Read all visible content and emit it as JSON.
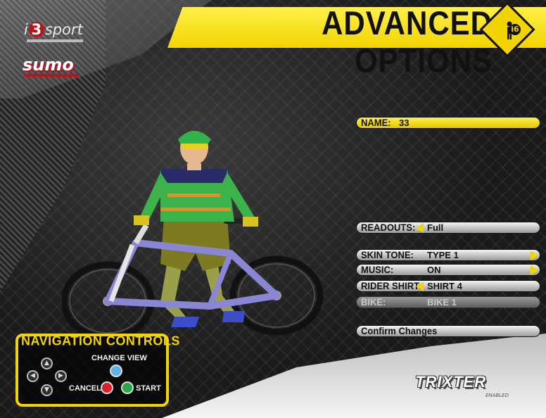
{
  "header": {
    "title": "ADVANCED OPTIONS",
    "rider_badge": "i6"
  },
  "logos": {
    "i3_left": "i",
    "i3_num": "3",
    "i3_right": "sport",
    "sumo": "sumo",
    "trixter": "TRIXTER",
    "trixter_sub": "ENABLED"
  },
  "name_field": {
    "label": "NAME:",
    "value": "33"
  },
  "options": {
    "readouts": {
      "label": "READOUTS:",
      "value": "Full"
    },
    "skin_tone": {
      "label": "SKIN TONE:",
      "value": "TYPE 1"
    },
    "music": {
      "label": "MUSIC:",
      "value": "ON"
    },
    "rider_shirt": {
      "label": "RIDER SHIRT:",
      "value": "SHIRT 4"
    },
    "bike": {
      "label": "BIKE:",
      "value": "BIKE 1"
    }
  },
  "confirm": {
    "label": "Confirm Changes"
  },
  "navigation": {
    "title": "NAVIGATION CONTROLS",
    "change_view": "CHANGE VIEW",
    "cancel": "CANCEL",
    "start": "START"
  },
  "colors": {
    "accent_yellow": "#f2d400",
    "cancel_red": "#d9232c",
    "start_green": "#2aa845",
    "view_blue": "#5fb3e6"
  }
}
